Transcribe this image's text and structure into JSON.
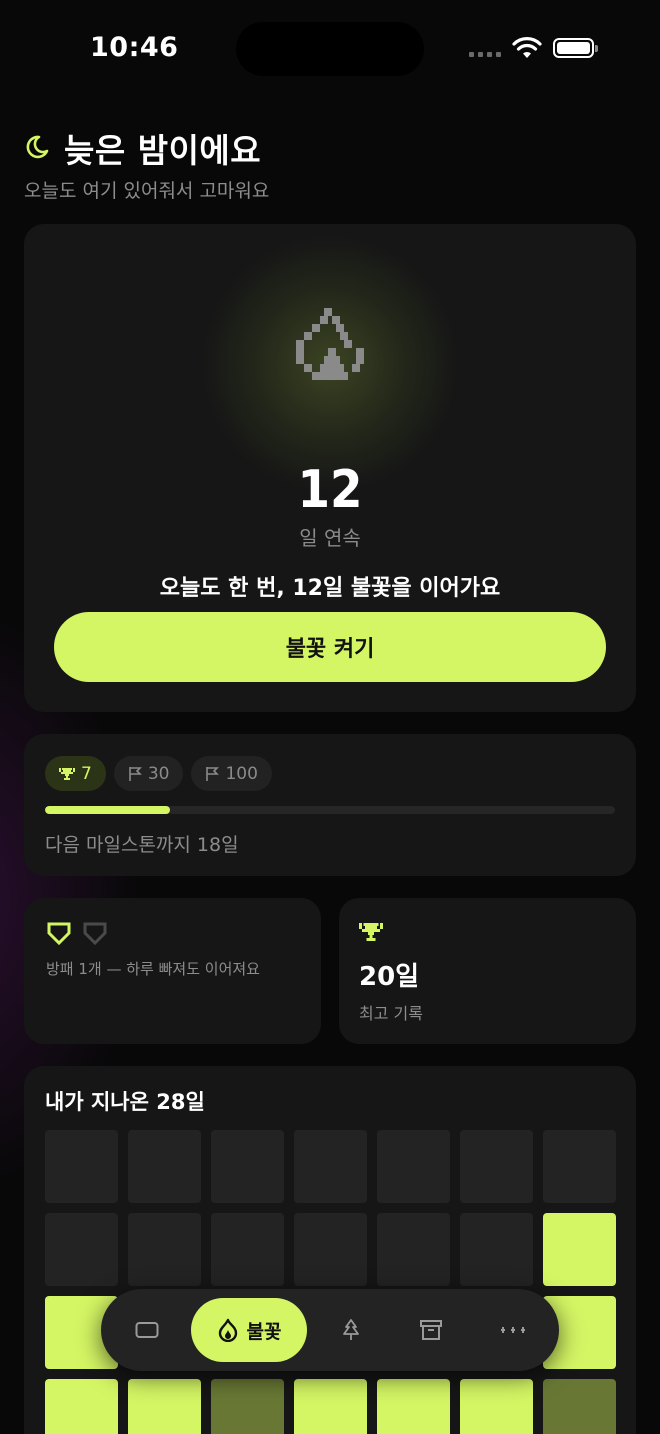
{
  "status_bar": {
    "time": "10:46"
  },
  "greeting": {
    "title": "늦은 밤이에요",
    "subtitle": "오늘도 여기 있어줘서 고마워요"
  },
  "streak": {
    "count": "12",
    "unit": "일 연속",
    "message": "오늘도 한 번, 12일 불꽃을 이어가요",
    "cta_label": "불꽃 켜기"
  },
  "milestones": {
    "chips": [
      {
        "value": "7",
        "icon": "trophy-icon",
        "active": true
      },
      {
        "value": "30",
        "icon": "flag-icon",
        "active": false
      },
      {
        "value": "100",
        "icon": "flag-icon",
        "active": false
      }
    ],
    "progress": 0.22,
    "text": "다음 마일스톤까지 18일"
  },
  "shields": {
    "owned": 1,
    "total": 2,
    "text": "방패 1개 — 하루 빠져도 이어져요"
  },
  "best": {
    "value": "20일",
    "label": "최고 기록"
  },
  "history": {
    "title": "내가 지나온 28일",
    "cells": [
      0,
      0,
      0,
      0,
      0,
      0,
      0,
      0,
      0,
      0,
      0,
      0,
      0,
      3,
      3,
      0,
      0,
      0,
      0,
      0,
      3,
      3,
      3,
      1,
      3,
      3,
      3,
      1
    ]
  },
  "nav": {
    "active_label": "불꽃"
  },
  "colors": {
    "accent": "#d4f564",
    "card": "#161616",
    "background": "#080808",
    "dim_cell": "#687834"
  }
}
